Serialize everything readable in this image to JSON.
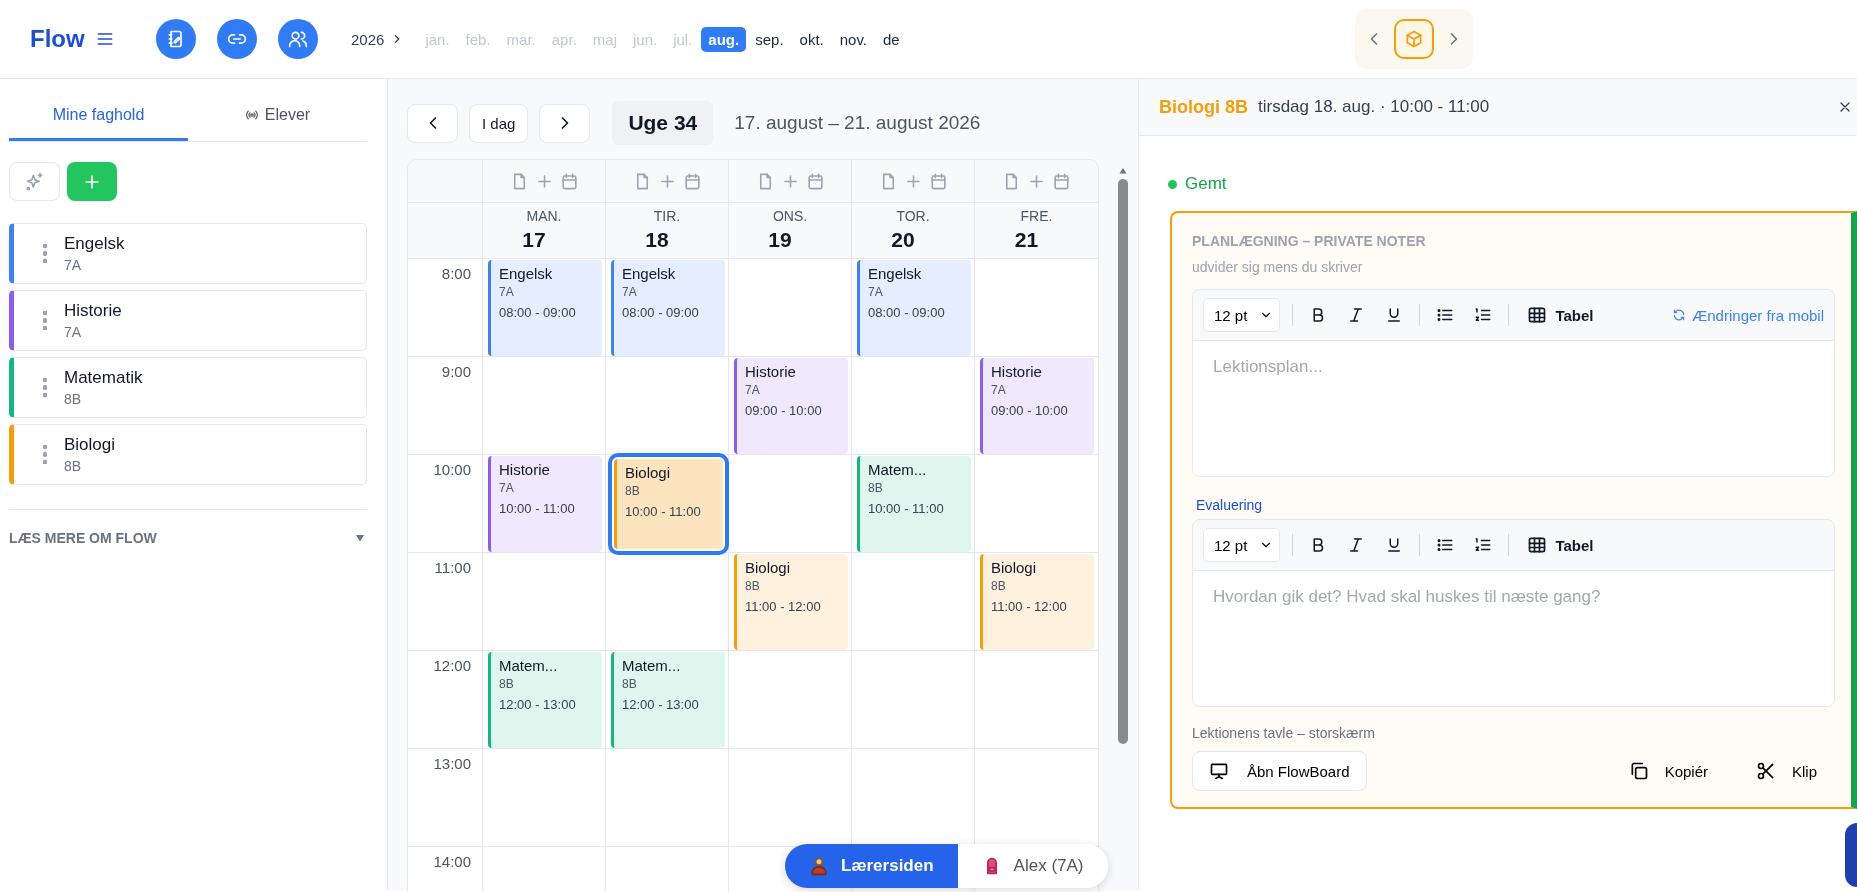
{
  "app": {
    "logo": "Flow"
  },
  "year": "2026",
  "months": [
    {
      "label": "jan.",
      "muted": true,
      "selected": false
    },
    {
      "label": "feb.",
      "muted": true,
      "selected": false
    },
    {
      "label": "mar.",
      "muted": true,
      "selected": false
    },
    {
      "label": "apr.",
      "muted": true,
      "selected": false
    },
    {
      "label": "maj",
      "muted": true,
      "selected": false
    },
    {
      "label": "jun.",
      "muted": true,
      "selected": false
    },
    {
      "label": "jul.",
      "muted": true,
      "selected": false
    },
    {
      "label": "aug.",
      "muted": false,
      "selected": true
    },
    {
      "label": "sep.",
      "muted": false,
      "selected": false
    },
    {
      "label": "okt.",
      "muted": false,
      "selected": false
    },
    {
      "label": "nov.",
      "muted": false,
      "selected": false
    },
    {
      "label": "de",
      "muted": false,
      "selected": false
    }
  ],
  "sidebar": {
    "tabs": [
      {
        "label": "Mine faghold",
        "selected": true
      },
      {
        "label": "Elever",
        "selected": false
      }
    ],
    "subjects": [
      {
        "name": "Engelsk",
        "class": "7A",
        "color": "#3b82f6"
      },
      {
        "name": "Historie",
        "class": "7A",
        "color": "#8b5cf6"
      },
      {
        "name": "Matematik",
        "class": "8B",
        "color": "#10b981"
      },
      {
        "name": "Biologi",
        "class": "8B",
        "color": "#f59e0b"
      }
    ],
    "more_label": "LÆS MERE OM FLOW"
  },
  "calendar": {
    "today_button": "I dag",
    "week": "Uge 34",
    "range": "17. august – 21. august 2026",
    "hours": [
      "8:00",
      "9:00",
      "10:00",
      "11:00",
      "12:00",
      "13:00",
      "14:00"
    ],
    "days": [
      {
        "weekday": "MAN.",
        "date": "17",
        "events": [
          {
            "subject": "Engelsk",
            "class": "7A",
            "time": "08:00 - 09:00",
            "color": "#3b82f6",
            "selected": false
          },
          {
            "subject": "Historie",
            "class": "7A",
            "time": "10:00 - 11:00",
            "color": "#8b5cf6",
            "selected": false
          },
          {
            "subject": "Matem...",
            "class": "8B",
            "time": "12:00 - 13:00",
            "color": "#10b981",
            "selected": false
          }
        ]
      },
      {
        "weekday": "TIR.",
        "date": "18",
        "events": [
          {
            "subject": "Engelsk",
            "class": "7A",
            "time": "08:00 - 09:00",
            "color": "#3b82f6",
            "selected": false
          },
          {
            "subject": "Biologi",
            "class": "8B",
            "time": "10:00 - 11:00",
            "color": "#f59e0b",
            "selected": true
          },
          {
            "subject": "Matem...",
            "class": "8B",
            "time": "12:00 - 13:00",
            "color": "#10b981",
            "selected": false
          }
        ]
      },
      {
        "weekday": "ONS.",
        "date": "19",
        "events": [
          {
            "subject": "Historie",
            "class": "7A",
            "time": "09:00 - 10:00",
            "color": "#8b5cf6",
            "selected": false
          },
          {
            "subject": "Biologi",
            "class": "8B",
            "time": "11:00 - 12:00",
            "color": "#f59e0b",
            "selected": false
          }
        ]
      },
      {
        "weekday": "TOR.",
        "date": "20",
        "events": [
          {
            "subject": "Engelsk",
            "class": "7A",
            "time": "08:00 - 09:00",
            "color": "#3b82f6",
            "selected": false
          },
          {
            "subject": "Matem...",
            "class": "8B",
            "time": "10:00 - 11:00",
            "color": "#10b981",
            "selected": false
          }
        ]
      },
      {
        "weekday": "FRE.",
        "date": "21",
        "events": [
          {
            "subject": "Historie",
            "class": "7A",
            "time": "09:00 - 10:00",
            "color": "#8b5cf6",
            "selected": false
          },
          {
            "subject": "Biologi",
            "class": "8B",
            "time": "11:00 - 12:00",
            "color": "#f59e0b",
            "selected": false
          }
        ]
      }
    ]
  },
  "view_switch": [
    {
      "label": "Lærersiden",
      "selected": true
    },
    {
      "label": "Alex (7A)",
      "selected": false
    }
  ],
  "detail": {
    "title": "Biologi 8B",
    "subtitle": "tirsdag 18. aug. · 10:00 - 11:00",
    "status": "Gemt",
    "heading": "PLANLÆGNING – PRIVATE NOTER",
    "hint": "udvider sig mens du skriver",
    "editors": [
      {
        "font_size": "12 pt",
        "table_label": "Tabel",
        "sync_link": "Ændringer fra mobil",
        "placeholder": "Lektionsplan..."
      },
      {
        "label": "Evaluering",
        "font_size": "12 pt",
        "table_label": "Tabel",
        "placeholder": "Hvordan gik det? Hvad skal huskes til næste gang?"
      }
    ],
    "board_label": "Lektionens tavle – storskærm",
    "board_button": "Åbn FlowBoard",
    "copy_button": "Kopiér",
    "cut_button": "Klip"
  }
}
